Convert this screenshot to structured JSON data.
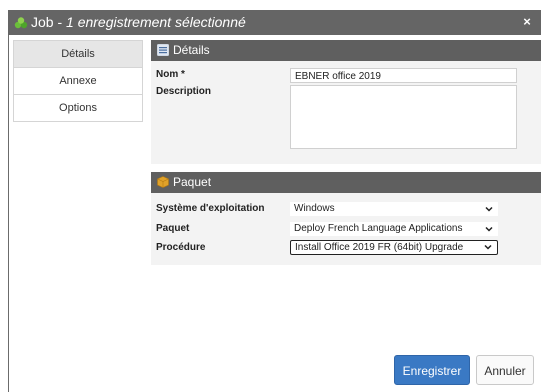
{
  "window": {
    "title_prefix": "Job - ",
    "title_suffix": "1 enregistrement sélectionné",
    "close_label": "×",
    "app_icon": "job-icon"
  },
  "sidebar": {
    "tabs": [
      {
        "label": "Détails",
        "active": true
      },
      {
        "label": "Annexe",
        "active": false
      },
      {
        "label": "Options",
        "active": false
      }
    ]
  },
  "details": {
    "header": "Détails",
    "icon": "list-icon",
    "name_label": "Nom *",
    "name_value": "EBNER office 2019",
    "description_label": "Description",
    "description_value": ""
  },
  "package": {
    "header": "Paquet",
    "icon": "package-icon",
    "os_label": "Système d'exploitation",
    "os_value": "Windows",
    "package_label": "Paquet",
    "package_value": "Deploy French Language Applications",
    "procedure_label": "Procédure",
    "procedure_value": "Install Office 2019 FR (64bit) Upgrade"
  },
  "footer": {
    "save_label": "Enregistrer",
    "cancel_label": "Annuler"
  },
  "colors": {
    "titlebar": "#656565",
    "section_header": "#5f5f5f",
    "primary_button": "#3a79c4"
  }
}
